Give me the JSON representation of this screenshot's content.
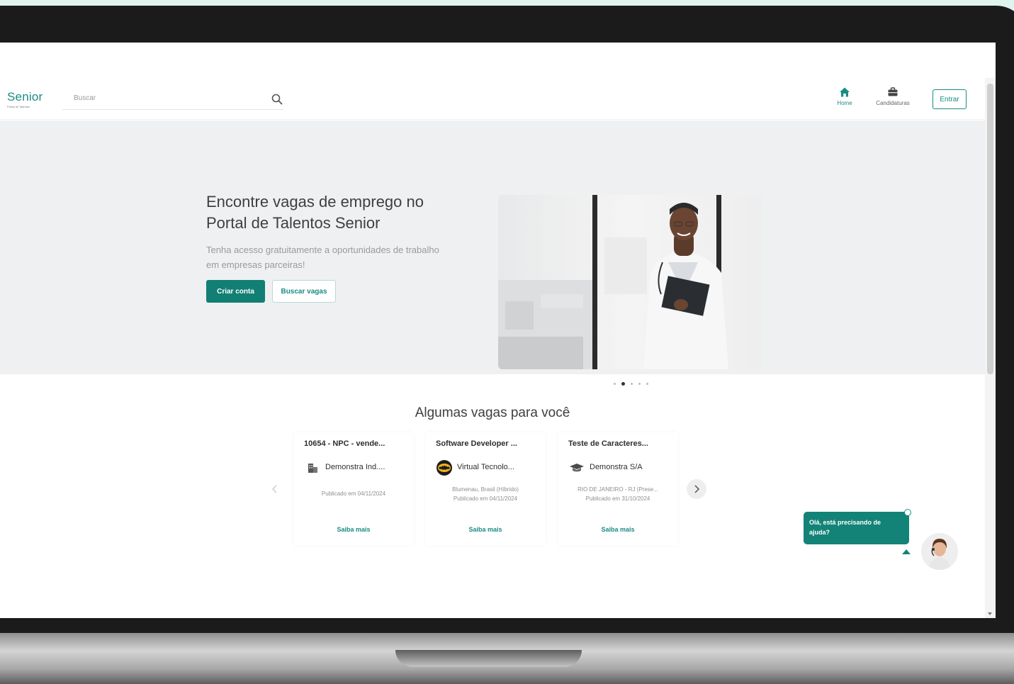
{
  "header": {
    "logo_text": "Senior",
    "logo_subtext": "Portal de Talentos",
    "search_placeholder": "Buscar",
    "nav": [
      {
        "label": "Home",
        "icon": "home-icon",
        "active": true
      },
      {
        "label": "Candidaturas",
        "icon": "briefcase-icon",
        "active": false
      }
    ],
    "login_label": "Entrar"
  },
  "hero": {
    "title": "Encontre vagas de emprego no Portal de Talentos Senior",
    "subtitle": "Tenha acesso gratuitamente a oportunidades de trabalho em empresas parceiras!",
    "primary_button": "Criar conta",
    "secondary_button": "Buscar vagas",
    "carousel_slides": 5,
    "carousel_active": 2
  },
  "jobs": {
    "title": "Algumas vagas para você",
    "items": [
      {
        "title": "10654 - NPC - vende...",
        "company": "Demonstra Ind....",
        "location": "",
        "published": "Publicado em 04/11/2024",
        "link": "Saiba mais"
      },
      {
        "title": "Software Developer ...",
        "company": "Virtual Tecnolo...",
        "location": "Blumenau, Brasil (Híbrido)",
        "published": "Publicado em 04/11/2024",
        "link": "Saiba mais"
      },
      {
        "title": "Teste de Caracteres...",
        "company": "Demonstra S/A",
        "location": "RIO DE JANEIRO - RJ (Prese...",
        "published": "Publicado em 31/10/2024",
        "link": "Saiba mais"
      }
    ]
  },
  "chat": {
    "message": "Olá, está precisando de ajuda?"
  },
  "colors": {
    "accent": "#1a8c83",
    "primary_button": "#117f74",
    "hero_bg": "#eff0f2",
    "page_bg": "#dff4ee"
  }
}
